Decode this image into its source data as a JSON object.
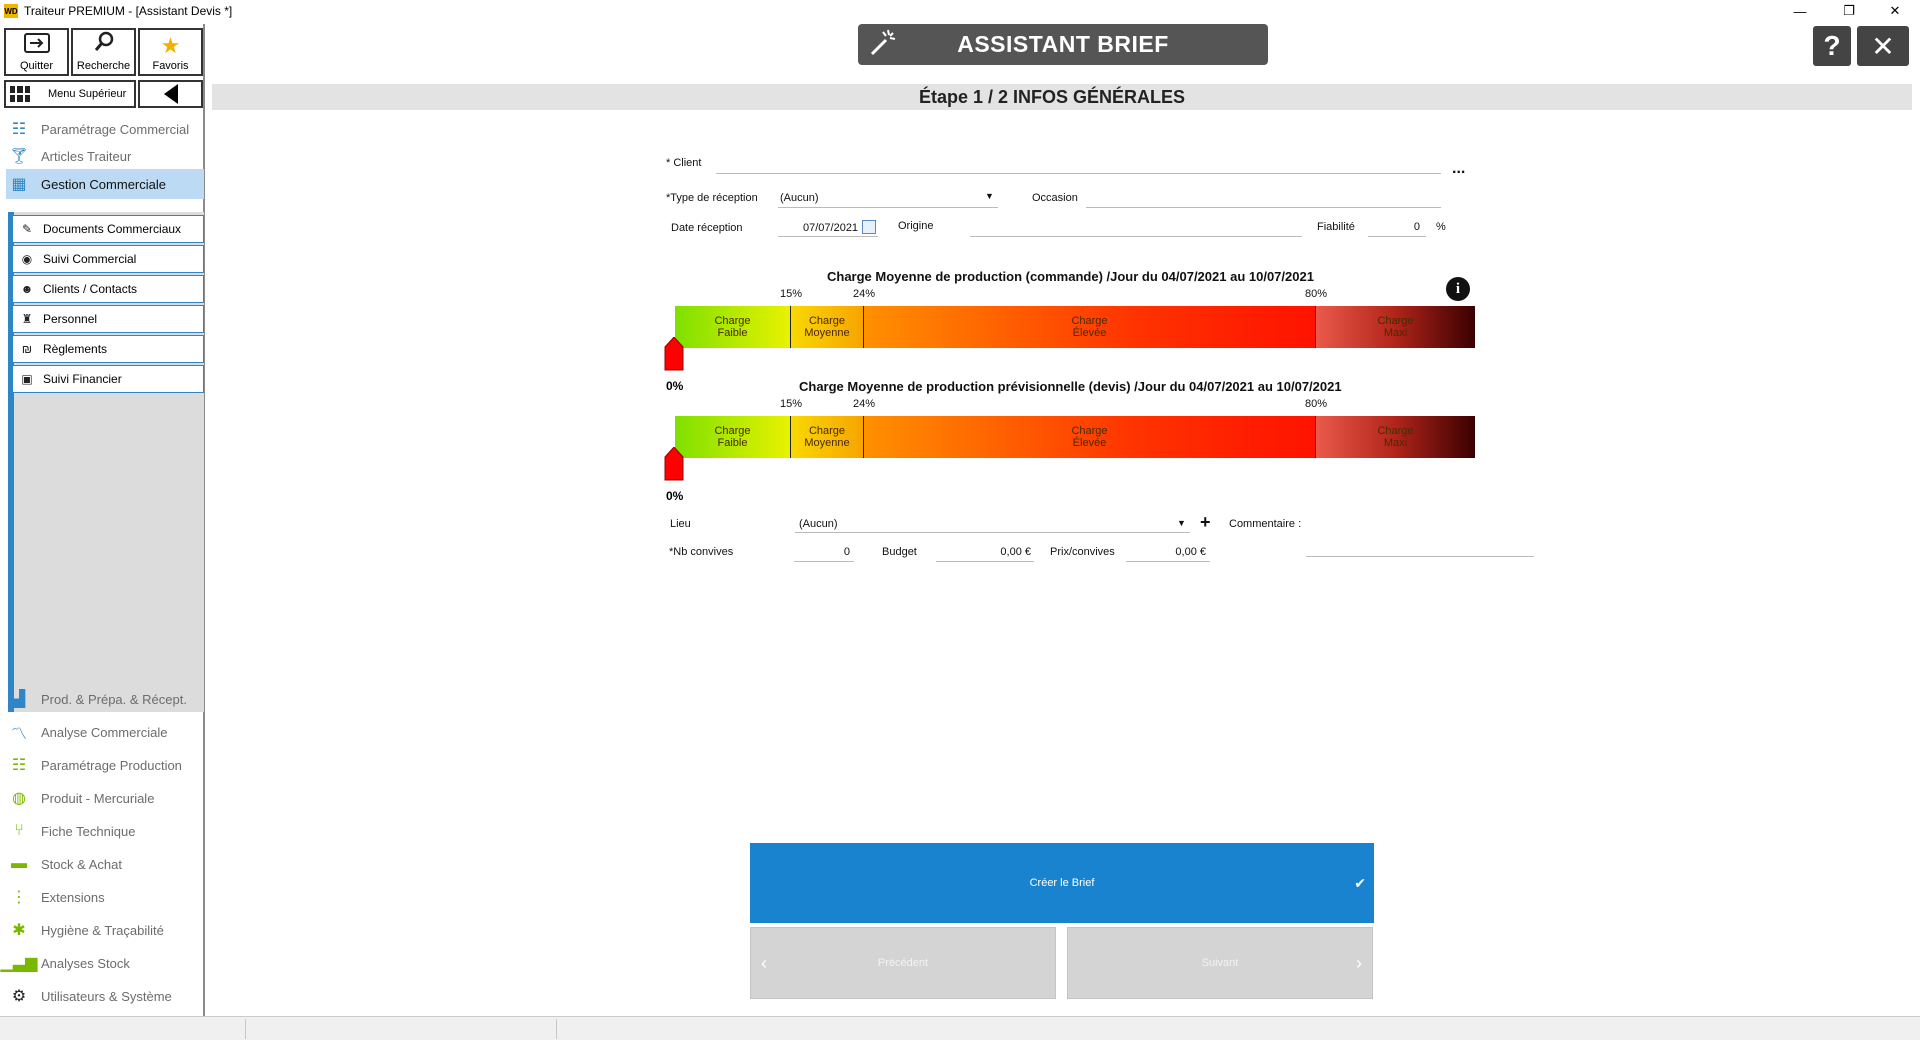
{
  "window": {
    "title": "Traiteur PREMIUM - [Assistant Devis *]",
    "logo": "WD",
    "controls": {
      "minimize": "—",
      "restore": "❐",
      "close": "✕"
    }
  },
  "toolbar": {
    "quit_label": "Quitter",
    "search_label": "Recherche",
    "favorites_label": "Favoris",
    "menu_label": "Menu Supérieur"
  },
  "sidebar": {
    "items_top": [
      {
        "label": "Paramétrage Commercial",
        "icon": "sliders-icon"
      },
      {
        "label": "Articles Traiteur",
        "icon": "cocktail-icon"
      },
      {
        "label": "Gestion Commerciale",
        "icon": "calculator-icon"
      }
    ],
    "subitems": [
      {
        "label": "Documents Commerciaux",
        "icon": "edit-doc-icon"
      },
      {
        "label": "Suivi Commercial",
        "icon": "eye-icon"
      },
      {
        "label": "Clients / Contacts",
        "icon": "contacts-icon"
      },
      {
        "label": "Personnel",
        "icon": "staff-icon"
      },
      {
        "label": "Règlements",
        "icon": "payment-icon"
      },
      {
        "label": "Suivi Financier",
        "icon": "finance-icon"
      }
    ],
    "items_bottom": [
      {
        "label": "Prod. & Prépa. &  Récept.",
        "icon": "factory-icon"
      },
      {
        "label": "Analyse Commerciale",
        "icon": "line-chart-icon"
      },
      {
        "label": "Paramétrage Production",
        "icon": "sliders-icon"
      },
      {
        "label": "Produit - Mercuriale",
        "icon": "food-icon"
      },
      {
        "label": "Fiche Technique",
        "icon": "cutlery-icon"
      },
      {
        "label": "Stock & Achat",
        "icon": "truck-icon"
      },
      {
        "label": "Extensions",
        "icon": "dots-vertical-icon"
      },
      {
        "label": "Hygiène & Traçabilité",
        "icon": "bug-icon"
      },
      {
        "label": "Analyses Stock",
        "icon": "bar-chart-icon"
      },
      {
        "label": "Utilisateurs & Système",
        "icon": "gear-icon"
      }
    ]
  },
  "header": {
    "title": "ASSISTANT BRIEF",
    "help_label": "?",
    "close_label": "✕",
    "step": "Étape 1 / 2  INFOS GÉNÉRALES"
  },
  "form": {
    "client_label": "* Client",
    "client_value": "",
    "client_more": "...",
    "reception_type_label": "*Type de réception",
    "reception_type_value": "(Aucun)",
    "occasion_label": "Occasion",
    "occasion_value": "",
    "date_label": "Date réception",
    "date_value": "07/07/2021",
    "origin_label": "Origine",
    "origin_value": "",
    "reliability_label": "Fiabilité",
    "reliability_value": "0",
    "reliability_unit": "%",
    "lieu_label": "Lieu",
    "lieu_value": "(Aucun)",
    "add_label": "+",
    "comment_label": "Commentaire :",
    "guests_label": "*Nb convives",
    "guests_value": "0",
    "budget_label": "Budget",
    "budget_value": "0,00 €",
    "price_label": "Prix/convives",
    "price_value": "0,00 €"
  },
  "gauges": [
    {
      "title": "Charge Moyenne de production (commande) /Jour du 04/07/2021 au 10/07/2021",
      "thresholds": [
        "15%",
        "24%",
        "80%"
      ],
      "segments": [
        {
          "line1": "Charge",
          "line2": "Faible"
        },
        {
          "line1": "Charge",
          "line2": "Moyenne"
        },
        {
          "line1": "Charge",
          "line2": "Élevée"
        },
        {
          "line1": "Charge",
          "line2": "Maxi"
        }
      ],
      "value_label": "0%",
      "value": 0
    },
    {
      "title": "Charge Moyenne de production prévisionnelle (devis) /Jour du 04/07/2021 au 10/07/2021",
      "thresholds": [
        "15%",
        "24%",
        "80%"
      ],
      "segments": [
        {
          "line1": "Charge",
          "line2": "Faible"
        },
        {
          "line1": "Charge",
          "line2": "Moyenne"
        },
        {
          "line1": "Charge",
          "line2": "Élevée"
        },
        {
          "line1": "Charge",
          "line2": "Maxi"
        }
      ],
      "value_label": "0%",
      "value": 0
    }
  ],
  "actions": {
    "create_label": "Créer le Brief",
    "create_check": "✔",
    "prev_label": "Précédent",
    "next_label": "Suivant",
    "prev_arrow": "‹",
    "next_arrow": "›"
  },
  "colors": {
    "accent": "#1a83cf",
    "header": "#555555",
    "marker": "#ff0000"
  }
}
